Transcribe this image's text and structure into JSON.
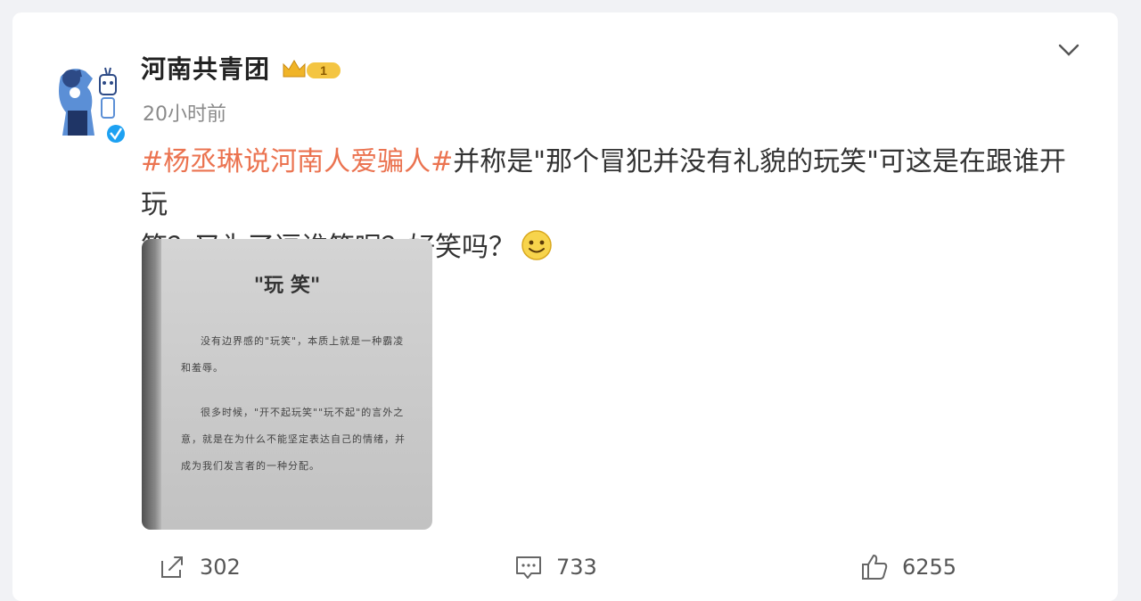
{
  "post": {
    "author": "河南共青团",
    "badge_level": "1",
    "timestamp": "20小时前",
    "topic": "#杨丞琳说河南人爱骗人#",
    "text_line1": "并称是\"那个冒犯并没有礼貌的玩笑\"可这是在跟谁开玩",
    "text_line2": "笑？又为了逗谁笑呢？好笑吗？",
    "emoji": "smile-emoji"
  },
  "photo": {
    "title": "\"玩 笑\"",
    "para1": "没有边界感的\"玩笑\"，本质上就是一种霸凌和羞辱。",
    "para2": "很多时候，\"开不起玩笑\"\"玩不起\"的言外之意，就是在为什么不能坚定表达自己的情绪，并成为我们发言者的一种分配。"
  },
  "actions": {
    "repost_count": "302",
    "comment_count": "733",
    "like_count": "6255"
  },
  "colors": {
    "topic": "#eb7350",
    "verified": "#1da1f2",
    "crown": "#f0b428"
  }
}
